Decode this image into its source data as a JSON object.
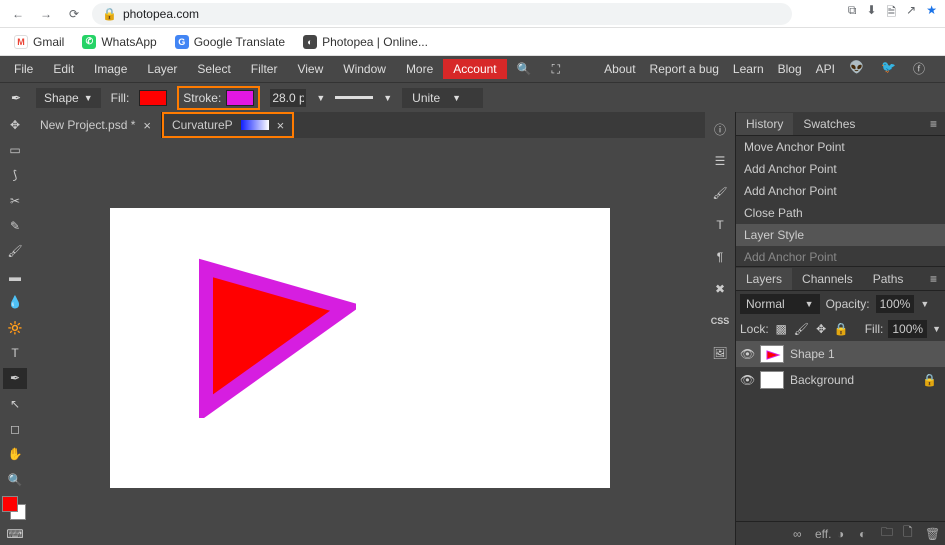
{
  "browser": {
    "url": "photopea.com"
  },
  "bookmarks": [
    {
      "label": "Gmail"
    },
    {
      "label": "WhatsApp"
    },
    {
      "label": "Google Translate"
    },
    {
      "label": "Photopea | Online..."
    }
  ],
  "menu": {
    "items": [
      "File",
      "Edit",
      "Image",
      "Layer",
      "Select",
      "Filter",
      "View",
      "Window",
      "More"
    ],
    "account": "Account",
    "right": [
      "About",
      "Report a bug",
      "Learn",
      "Blog",
      "API"
    ]
  },
  "options": {
    "shape": "Shape",
    "fill_label": "Fill:",
    "stroke_label": "Stroke:",
    "stroke_width": "28.0 p",
    "mode": "Unite",
    "fill_color": "#ff0000",
    "stroke_color": "#e217e2"
  },
  "tabs": [
    {
      "label": "New Project.psd *"
    },
    {
      "label": "CurvatureP"
    }
  ],
  "panels": {
    "history_tab": "History",
    "swatches_tab": "Swatches",
    "history": [
      "Move Anchor Point",
      "Add Anchor Point",
      "Add Anchor Point",
      "Close Path",
      "Layer Style",
      "Add Anchor Point"
    ],
    "layers_tab": "Layers",
    "channels_tab": "Channels",
    "paths_tab": "Paths",
    "blend": "Normal",
    "opacity_label": "Opacity:",
    "opacity_val": "100%",
    "lock_label": "Lock:",
    "fill_label": "Fill:",
    "fill_val": "100%",
    "layer1": "Shape 1",
    "layer2": "Background"
  }
}
